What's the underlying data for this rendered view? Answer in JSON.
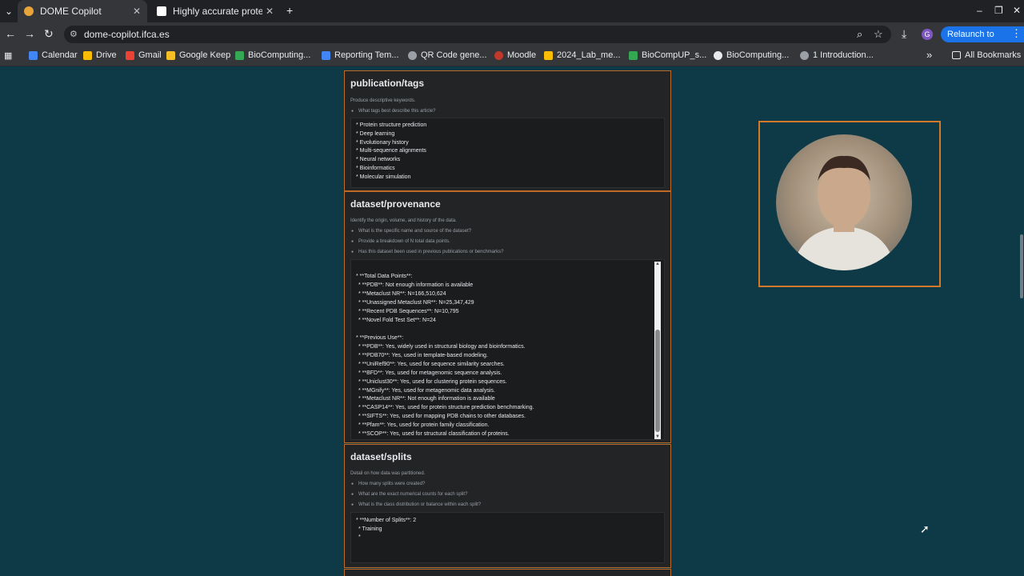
{
  "browser": {
    "tabs": [
      {
        "title": "DOME Copilot",
        "active": true
      },
      {
        "title": "Highly accurate protein",
        "active": false
      }
    ],
    "new_tab": "+",
    "url": "dome-copilot.ifca.es",
    "relaunch_label": "Relaunch to update",
    "profile_initial": "G",
    "bookmarks": [
      "Calendar",
      "Drive",
      "Gmail",
      "Google Keep",
      "BioComputing...",
      "Reporting Tem...",
      "QR Code gene...",
      "Moodle",
      "2024_Lab_me...",
      "BioCompUP_s...",
      "BioComputing...",
      "1  Introduction..."
    ],
    "overflow": "»",
    "all_bookmarks": "All Bookmarks"
  },
  "sections": {
    "tags": {
      "title": "publication/tags",
      "desc": "Produce descriptive keywords.",
      "questions": [
        "What tags best describe this article?"
      ],
      "answer": [
        "* Protein structure prediction",
        "* Deep learning",
        "* Evolutionary history",
        "* Multi-sequence alignments",
        "* Neural networks",
        "* Bioinformatics",
        "* Molecular simulation"
      ]
    },
    "provenance": {
      "title": "dataset/provenance",
      "desc": "Identify the origin, volume, and history of the data.",
      "questions": [
        "What is the specific name and source of the dataset?",
        "Provide a breakdown of N total data points.",
        "Has this dataset been used in previous publications or benchmarks?"
      ],
      "answer": [
        "* **Total Data Points**:",
        "  * **PDB**: Not enough information is available",
        "  * **Metaclust NR**: N=166,510,624",
        "  * **Unassigned Metaclust NR**: N=25,347,429",
        "  * **Recent PDB Sequences**: N=10,795",
        "  * **Novel Fold Test Set**: N=24",
        "",
        "* **Previous Use**:",
        "  * **PDB**: Yes, widely used in structural biology and bioinformatics.",
        "  * **PDB70**: Yes, used in template-based modeling.",
        "  * **UniRef90**: Yes, used for sequence similarity searches.",
        "  * **BFD**: Yes, used for metagenomic sequence analysis.",
        "  * **Uniclust30**: Yes, used for clustering protein sequences.",
        "  * **MGnify**: Yes, used for metagenomic data analysis.",
        "  * **Metaclust NR**: Not enough information is available",
        "  * **CASP14**: Yes, used for protein structure prediction benchmarking.",
        "  * **SIFTS**: Yes, used for mapping PDB chains to other databases.",
        "  * **Pfam**: Yes, used for protein family classification.",
        "  * **SCOP**: Yes, used for structural classification of proteins."
      ]
    },
    "splits": {
      "title": "dataset/splits",
      "desc": "Detail on how data was partitioned.",
      "questions": [
        "How many splits were created?",
        "What are the exact numerical counts for each split?",
        "What is the class distribution or balance within each split?"
      ],
      "answer": [
        "* **Number of Splits**: 2",
        "  * Training",
        "  *"
      ]
    }
  },
  "colors": {
    "accent": "#c06a28",
    "page_bg": "#0e3a48",
    "panel_bg": "#222426"
  }
}
